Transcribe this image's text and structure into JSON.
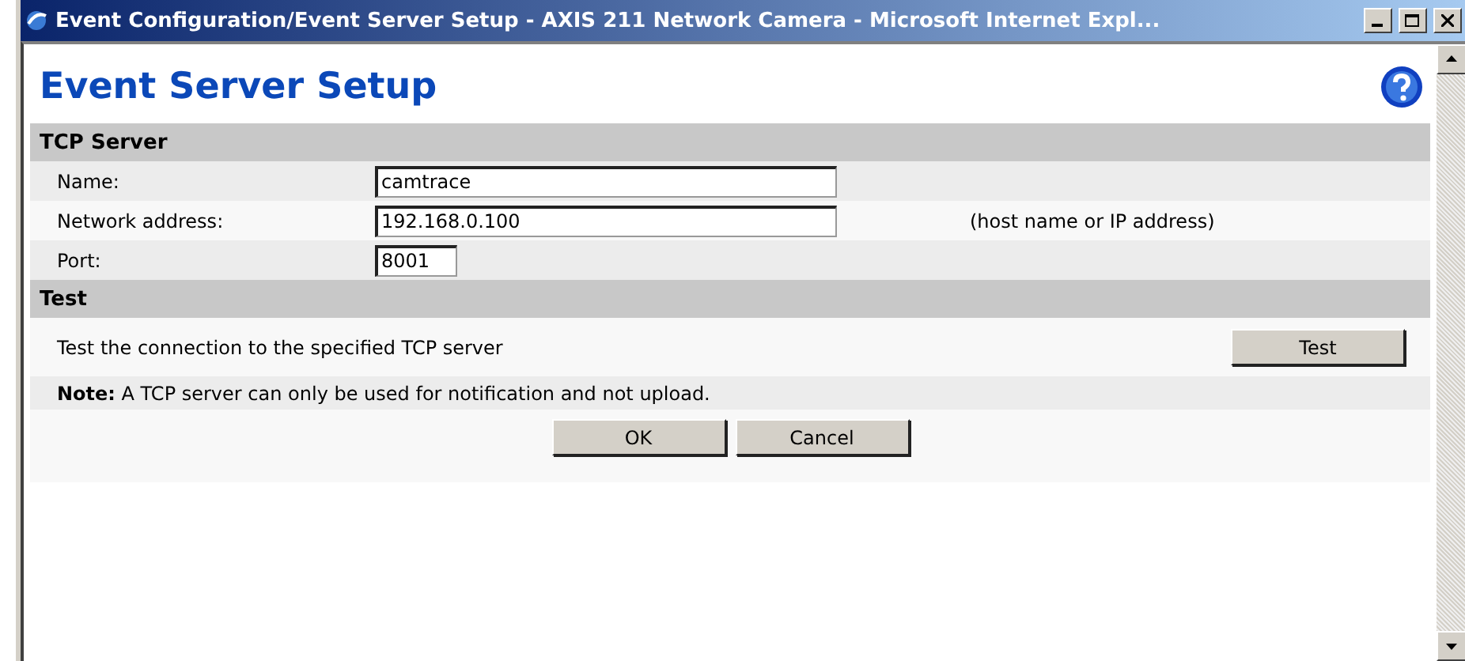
{
  "window": {
    "title": "Event Configuration/Event Server Setup - AXIS 211 Network Camera - Microsoft Internet Expl..."
  },
  "page": {
    "heading": "Event Server Setup"
  },
  "sections": [
    {
      "title": "TCP Server",
      "rows": [
        {
          "kind": "field",
          "label": "Name:",
          "value": "camtrace"
        },
        {
          "kind": "field",
          "label": "Network address:",
          "value": "192.168.0.100",
          "hint": "(host name or IP address)"
        },
        {
          "kind": "short-field",
          "label": "Port:",
          "value": "8001"
        }
      ]
    },
    {
      "title": "Test",
      "rows": [
        {
          "kind": "action",
          "text": "Test the connection to the specified TCP server",
          "button": "Test"
        },
        {
          "kind": "note",
          "text": "**Note:** A TCP server can only be used for notification and not upload."
        }
      ]
    }
  ],
  "buttons": [
    "OK",
    "Cancel"
  ]
}
